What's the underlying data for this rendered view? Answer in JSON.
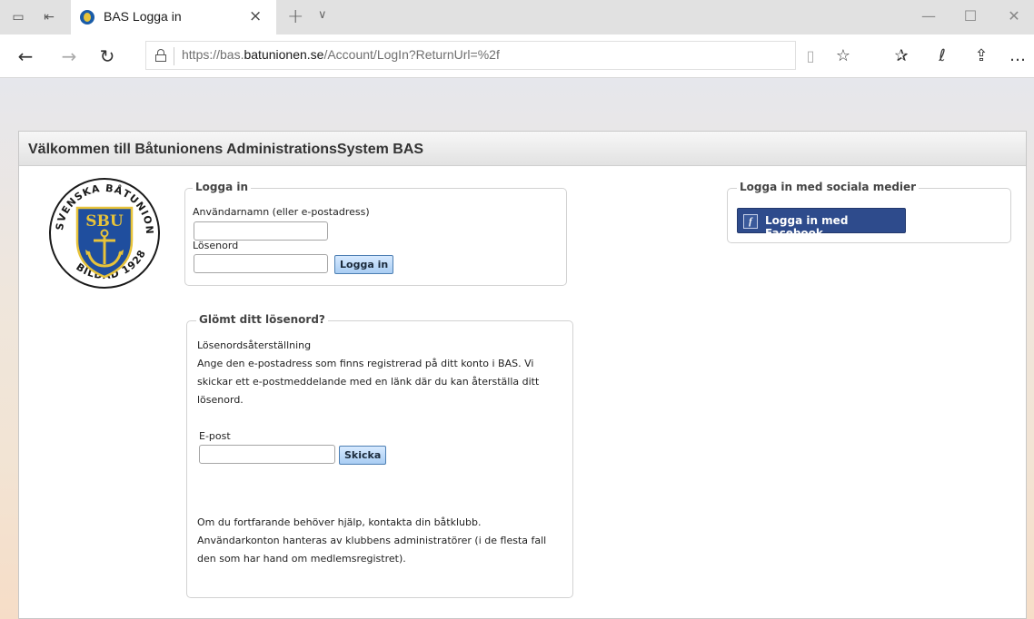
{
  "browser": {
    "tab_title": "BAS Logga in",
    "tab_close_glyph": "×",
    "new_tab_glyph": "+",
    "tab_list_glyph": "∨",
    "url_host_prefix": "https://bas.",
    "url_host": "batunionen.se",
    "url_path": "/Account/LogIn?ReturnUrl=%2f",
    "favicon": "sbu-favicon",
    "window_controls": [
      "minimize",
      "maximize",
      "close"
    ]
  },
  "page": {
    "header_title": "Välkommen till Båtunionens AdministrationsSystem BAS",
    "logo": {
      "center_text": "SBU",
      "ring_text": "SVENSKA BÅTUNIONEN • BILDAD 1928 •",
      "colors": {
        "blue": "#1f4e9e",
        "gold": "#e7c33a"
      }
    },
    "login": {
      "legend": "Logga in",
      "username_label": "Användarnamn (eller e-postadress)",
      "username_value": "",
      "password_label": "Lösenord",
      "password_value": "",
      "submit_label": "Logga in"
    },
    "social": {
      "legend": "Logga in med sociala medier",
      "facebook_label": "Logga in med Facebook",
      "facebook_icon_glyph": "f",
      "facebook_color": "#2e4b8c"
    },
    "forgot": {
      "legend": "Glömt ditt lösenord?",
      "heading": "Lösenordsåterställning",
      "text_lines": [
        "Ange den e-postadress som finns registrerad på ditt konto i BAS. Vi",
        "skickar ett e-postmeddelande med en länk där du kan återställa ditt",
        "lösenord."
      ],
      "email_label": "E-post",
      "email_value": "",
      "submit_label": "Skicka",
      "help_lines": [
        "Om du fortfarande behöver hjälp, kontakta din båtklubb.",
        "Användarkonton hanteras av klubbens administratörer (i de flesta fall",
        "den som har hand om medlemsregistret)."
      ]
    }
  }
}
